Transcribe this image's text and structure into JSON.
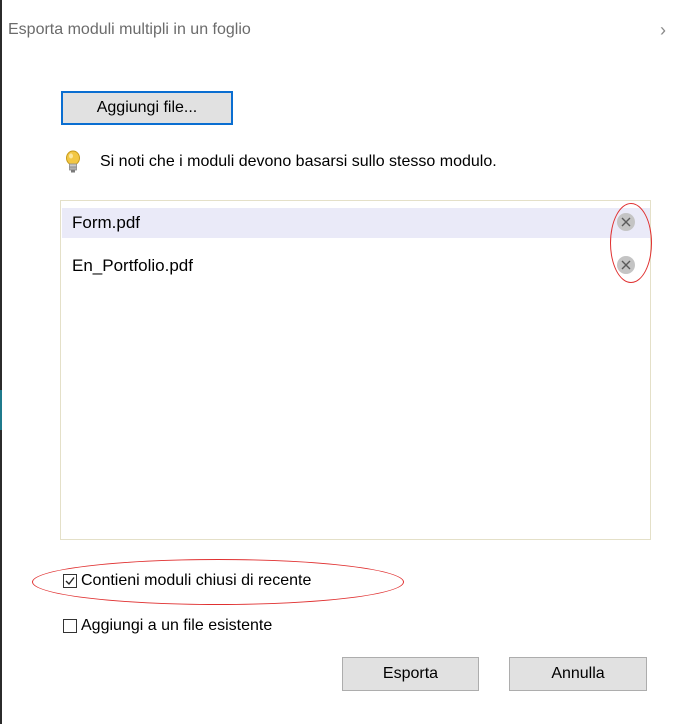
{
  "dialog": {
    "title": "Esporta moduli multipli in un foglio"
  },
  "toolbar": {
    "add_file_label": "Aggiungi file..."
  },
  "hint": {
    "icon": "lightbulb-icon",
    "text": "Si noti che i moduli devono basarsi sullo stesso modulo."
  },
  "file_list": {
    "items": [
      {
        "name": "Form.pdf",
        "selected": true
      },
      {
        "name": "En_Portfolio.pdf",
        "selected": false
      }
    ]
  },
  "options": {
    "include_recent": {
      "label": "Contieni moduli chiusi di recente",
      "checked": true
    },
    "append_existing": {
      "label": "Aggiungi a un file esistente",
      "checked": false
    }
  },
  "buttons": {
    "export_label": "Esporta",
    "cancel_label": "Annulla"
  },
  "colors": {
    "accent_border": "#0a6ed1",
    "annotation_red": "#e03030",
    "selection": "#eaeaf8"
  }
}
